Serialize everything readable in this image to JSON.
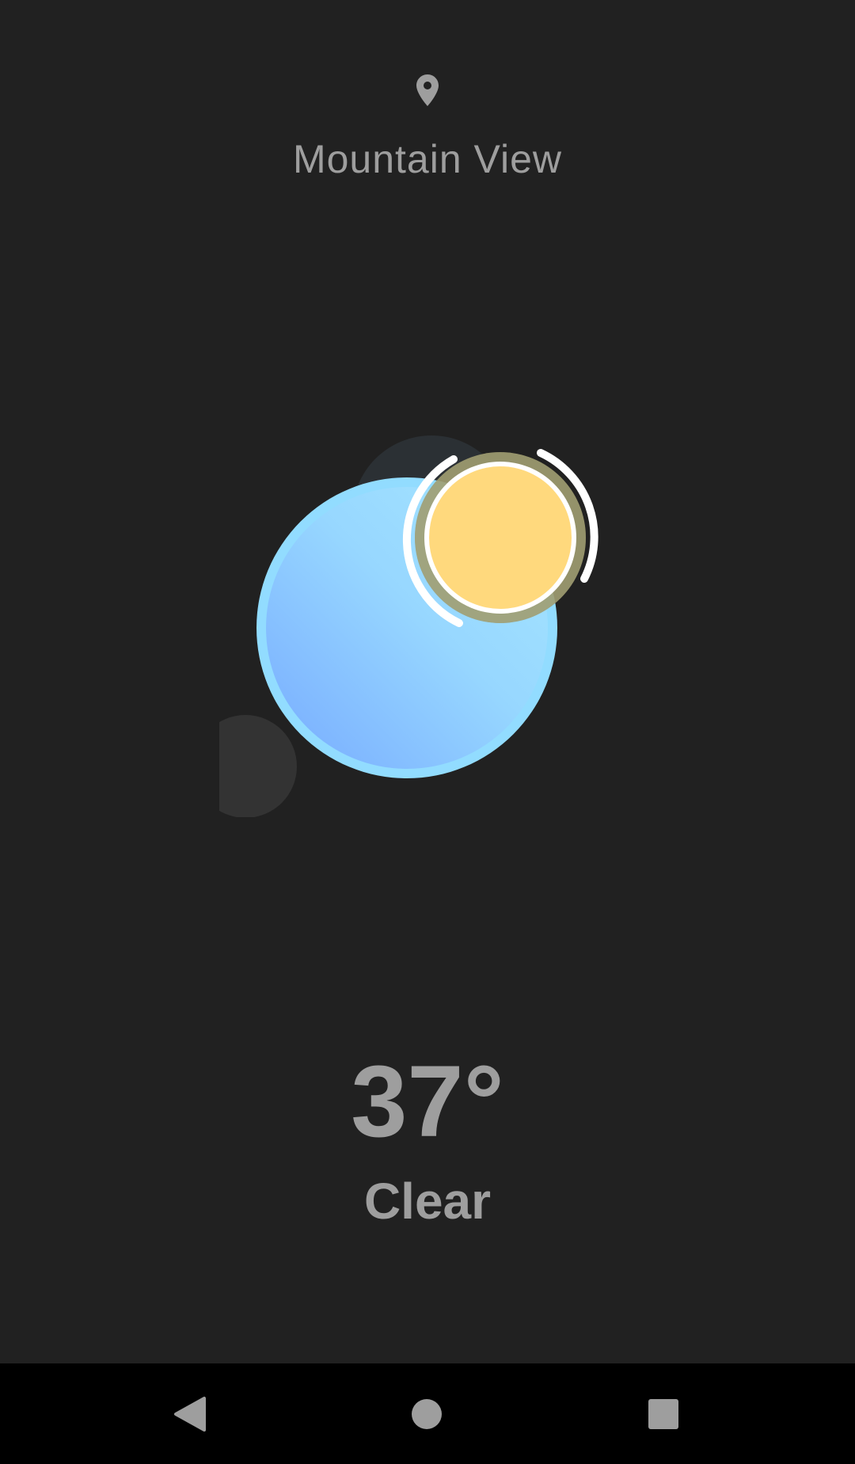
{
  "header": {
    "location_icon": "location-pin-icon",
    "location": "Mountain View"
  },
  "weather": {
    "temperature": "37°",
    "condition": "Clear",
    "illustration_icons": [
      "cloud-icon",
      "sun-icon"
    ]
  },
  "colors": {
    "background": "#212121",
    "text": "#9e9e9e",
    "sun": "#ffd97d",
    "sky_light": "#98dcff",
    "sky_dark": "#7fb5ff"
  },
  "nav": {
    "back_icon": "back-triangle-icon",
    "home_icon": "home-circle-icon",
    "recents_icon": "recents-square-icon"
  }
}
